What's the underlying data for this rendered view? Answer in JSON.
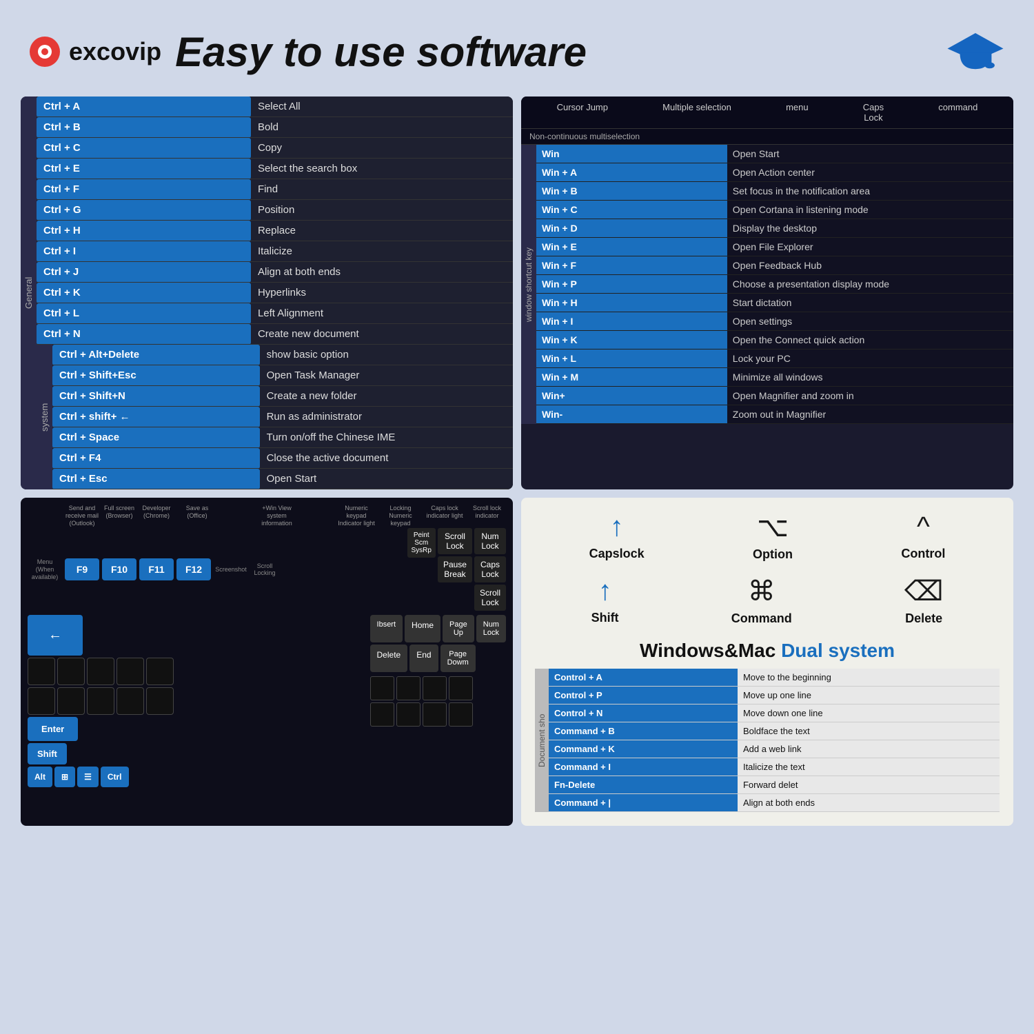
{
  "header": {
    "logo_text": "excovip",
    "title": "Easy to use software"
  },
  "general_section": {
    "label": "General",
    "shortcuts": [
      {
        "key": "Ctrl + A",
        "action": "Select All"
      },
      {
        "key": "Ctrl + B",
        "action": "Bold"
      },
      {
        "key": "Ctrl + C",
        "action": "Copy"
      },
      {
        "key": "Ctrl + E",
        "action": "Select the search box"
      },
      {
        "key": "Ctrl + F",
        "action": "Find"
      },
      {
        "key": "Ctrl + G",
        "action": "Position"
      },
      {
        "key": "Ctrl + H",
        "action": "Replace"
      },
      {
        "key": "Ctrl + I",
        "action": "Italicize"
      },
      {
        "key": "Ctrl + J",
        "action": "Align at both ends"
      },
      {
        "key": "Ctrl + K",
        "action": "Hyperlinks"
      },
      {
        "key": "Ctrl + L",
        "action": "Left Alignment"
      },
      {
        "key": "Ctrl + N",
        "action": "Create new document"
      }
    ]
  },
  "system_section": {
    "label": "system",
    "shortcuts": [
      {
        "key": "Ctrl + Alt+Delete",
        "action": "show basic option"
      },
      {
        "key": "Ctrl + Shift+Esc",
        "action": "Open Task Manager"
      },
      {
        "key": "Ctrl + Shift+N",
        "action": "Create a new folder"
      },
      {
        "key": "Ctrl + shift+ ←",
        "action": "Run as administrator"
      },
      {
        "key": "Ctrl + Space",
        "action": "Turn on/off the Chinese IME"
      },
      {
        "key": "Ctrl + F4",
        "action": "Close the active document"
      },
      {
        "key": "Ctrl + Esc",
        "action": "Open Start"
      }
    ]
  },
  "win_header": {
    "col1": "Cursor Jump",
    "col2": "Multiple selection",
    "col3": "menu",
    "col4": "Caps Lock",
    "col5": "command",
    "col6": "Non-continuous",
    "col7": "multiselection"
  },
  "win_section": {
    "label": "window shortcut key",
    "shortcuts": [
      {
        "key": "Win",
        "action": "Open Start"
      },
      {
        "key": "Win + A",
        "action": "Open Action center"
      },
      {
        "key": "Win + B",
        "action": "Set focus in the notification area"
      },
      {
        "key": "Win + C",
        "action": "Open Cortana in listening mode"
      },
      {
        "key": "Win + D",
        "action": "Display the desktop"
      },
      {
        "key": "Win + E",
        "action": "Open File Explorer"
      },
      {
        "key": "Win + F",
        "action": "Open Feedback Hub"
      },
      {
        "key": "Win + P",
        "action": "Choose a presentation display mode"
      },
      {
        "key": "Win + H",
        "action": "Start dictation"
      },
      {
        "key": "Win + I",
        "action": "Open settings"
      },
      {
        "key": "Win + K",
        "action": "Open the Connect quick action"
      },
      {
        "key": "Win + L",
        "action": "Lock your PC"
      },
      {
        "key": "Win + M",
        "action": "Minimize all windows"
      },
      {
        "key": "Win+",
        "action": "Open Magnifier and zoom in"
      },
      {
        "key": "Win-",
        "action": "Zoom out in Magnifier"
      }
    ]
  },
  "keyboard_panel": {
    "fn_keys": [
      {
        "key": "F9",
        "label1": "Send and",
        "label2": "receive mail",
        "label3": "(Outlook)"
      },
      {
        "key": "F10",
        "label1": "Full screen",
        "label2": "(Browser)"
      },
      {
        "key": "F11",
        "label1": "Developer",
        "label2": "(Chrome)"
      },
      {
        "key": "F12",
        "label1": "Save as",
        "label2": "(Office)"
      }
    ],
    "fn_labels": [
      "Menu\n(When available)",
      "Screenshot",
      "Scroll\nLocking",
      "+Win\nView system\ninformation",
      "Numeric keypad\nIndicator light",
      "Locking\nNumeric keypad",
      "Caps lock\nindicator light",
      "Scroll lock\nindicator"
    ],
    "other_keys": [
      "Scroll\nLock",
      "Pause\nBreak",
      "Num\nLock",
      "Caps\nLock",
      "Scroll\nLock"
    ],
    "nav_keys": [
      "Ibsert",
      "Home",
      "Page\nUp",
      "Num\nLock",
      "Delete",
      "End",
      "Page\nDown"
    ],
    "special_keys": [
      "Peint\nScm\nSysRq"
    ],
    "bottom_keys": [
      "Alt",
      "Win",
      "☰",
      "Ctrl"
    ],
    "arrow_label": "←",
    "enter_label": "Enter",
    "shift_label": "Shift"
  },
  "mac_section": {
    "keys": [
      {
        "symbol": "↑",
        "label": "Capslock"
      },
      {
        "symbol": "⌥",
        "label": "Option"
      },
      {
        "symbol": "^",
        "label": "Control"
      },
      {
        "symbol": "↑",
        "label": "Shift"
      },
      {
        "symbol": "⌘",
        "label": "Command"
      },
      {
        "symbol": "⌫",
        "label": "Delete"
      }
    ],
    "dual_title_white": "Windows&Mac",
    "dual_title_blue": "Dual system",
    "doc_label": "Document sho",
    "shortcuts": [
      {
        "key": "Control + A",
        "action": "Move to the beginning"
      },
      {
        "key": "Control + P",
        "action": "Move up one line"
      },
      {
        "key": "Control + N",
        "action": "Move down one line"
      },
      {
        "key": "Command + B",
        "action": "Boldface the text"
      },
      {
        "key": "Command + K",
        "action": "Add a web link"
      },
      {
        "key": "Command + I",
        "action": "Italicize the text"
      },
      {
        "key": "Fn-Delete",
        "action": "Forward delet"
      },
      {
        "key": "Command + |",
        "action": "Align at both ends"
      }
    ]
  }
}
